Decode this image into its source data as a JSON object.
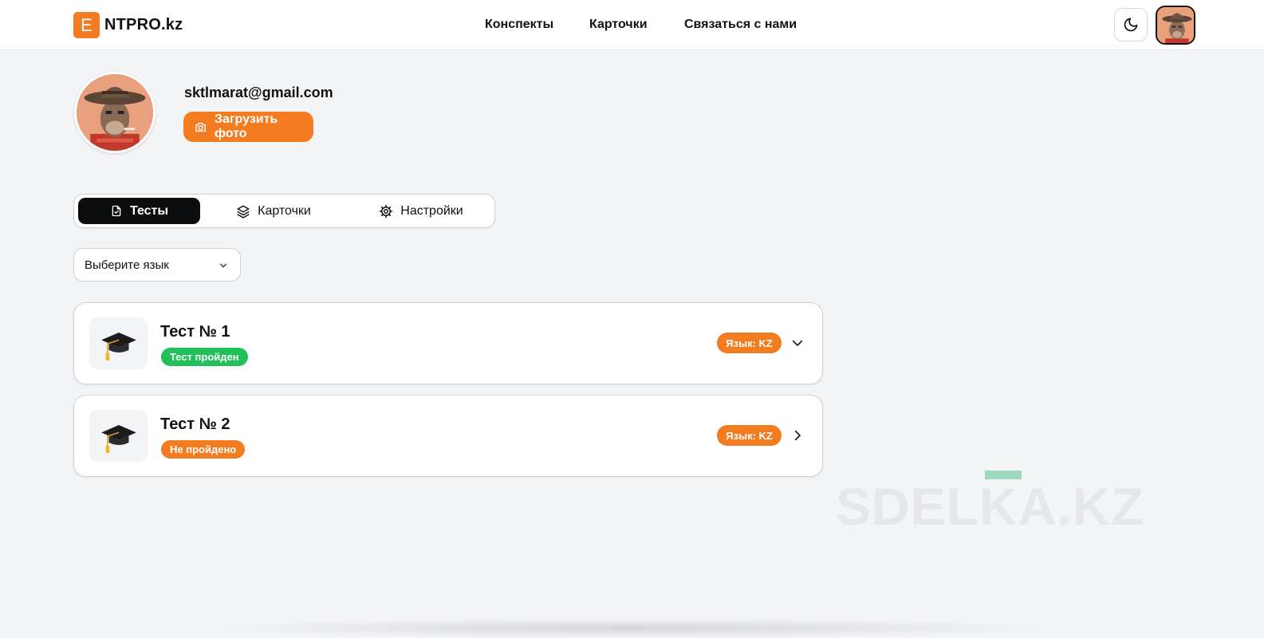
{
  "header": {
    "logo_letter": "E",
    "logo_text": "NTPRO.kz",
    "nav": [
      "Конспекты",
      "Карточки",
      "Связаться с нами"
    ],
    "theme_icon": "moon-icon",
    "avatar_icon": "avatar"
  },
  "profile": {
    "email": "sktlmarat@gmail.com",
    "upload_label": "Загрузить фото",
    "upload_icon": "camera-icon"
  },
  "tabs": [
    {
      "label": "Тесты",
      "icon": "file-check-icon",
      "active": true
    },
    {
      "label": "Карточки",
      "icon": "layers-icon",
      "active": false
    },
    {
      "label": "Настройки",
      "icon": "gear-icon",
      "active": false
    }
  ],
  "language_select": {
    "value": "Выберите язык",
    "icon": "chevron-down-icon"
  },
  "tests": [
    {
      "title": "Тест № 1",
      "status": "Тест пройден",
      "status_color": "#22c05a",
      "language": "Язык: KZ",
      "chevron": "chevron-down-icon"
    },
    {
      "title": "Тест № 2",
      "status": "Не пройдено",
      "status_color": "#f47c20",
      "language": "Язык: KZ",
      "chevron": "chevron-right-icon"
    }
  ],
  "watermark": "SDELKA.KZ",
  "colors": {
    "accent": "#f47c20",
    "success": "#22c05a",
    "tab_active": "#0b0c0e",
    "background": "#f3f4f6"
  }
}
